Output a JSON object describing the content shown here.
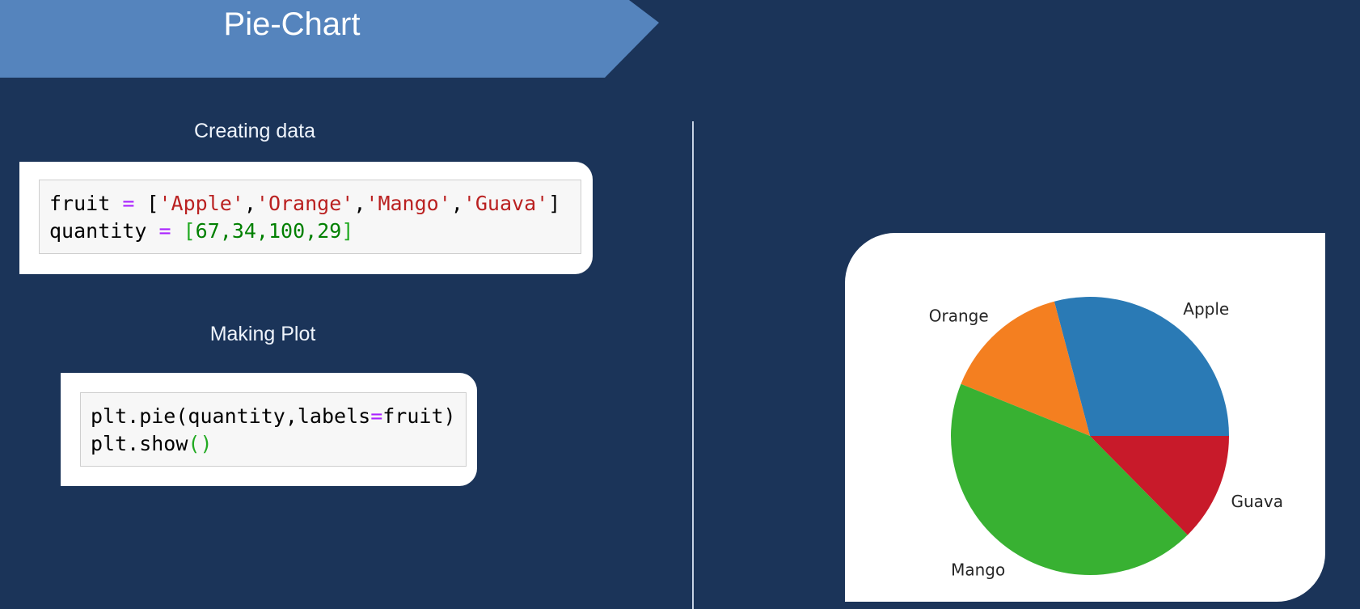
{
  "header": {
    "title": "Pie-Chart"
  },
  "left": {
    "data_section": {
      "label": "Creating data",
      "code": {
        "line1": {
          "var": "fruit",
          "eq": " = ",
          "open": "[",
          "items": [
            "'Apple'",
            "'Orange'",
            "'Mango'",
            "'Guava'"
          ],
          "sep": ",",
          "close": "]"
        },
        "line2": {
          "var": "quantity",
          "eq": " = ",
          "open": "[",
          "items": [
            "67",
            "34",
            "100",
            "29"
          ],
          "sep": ",",
          "close": "]"
        }
      }
    },
    "plot_section": {
      "label": "Making Plot",
      "code": {
        "line1": {
          "pre": "plt.pie(quantity,labels",
          "op": "=",
          "post": "fruit)"
        },
        "line2": {
          "pre": "plt.show",
          "paren": "()"
        }
      }
    }
  },
  "colors": {
    "background": "#1b3459",
    "banner": "#5584bd",
    "apple": "#2a7ab5",
    "orange": "#f47f20",
    "mango": "#38b132",
    "guava": "#c81a2a"
  },
  "chart_data": {
    "type": "pie",
    "labels": [
      "Apple",
      "Orange",
      "Mango",
      "Guava"
    ],
    "values": [
      67,
      34,
      100,
      29
    ],
    "colors": [
      "#2a7ab5",
      "#f47f20",
      "#38b132",
      "#c81a2a"
    ],
    "start_angle": 0,
    "direction": "counterclockwise"
  }
}
